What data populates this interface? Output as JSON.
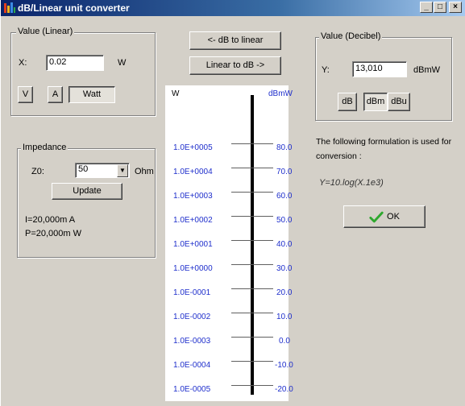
{
  "window": {
    "title": "dB/Linear unit converter",
    "controls": {
      "minimize": "_",
      "maximize": "□",
      "close": "×"
    }
  },
  "linear_group": {
    "legend": "Value (Linear)",
    "x_label": "X:",
    "x_value": "0.02",
    "unit": "W",
    "unit_buttons": [
      "V",
      "A",
      "Watt"
    ],
    "selected_unit": "Watt"
  },
  "impedance_group": {
    "legend": "Impedance",
    "z_label": "Z0:",
    "z_value": "50",
    "unit": "Ohm",
    "update_label": "Update",
    "current_text": "I=20,000m A",
    "power_text": "P=20,000m W"
  },
  "center_buttons": {
    "db_to_linear": "<- dB to linear",
    "linear_to_db": "Linear to dB ->"
  },
  "scale": {
    "left_header": "W",
    "right_header": "dBmW",
    "left_labels": [
      "1.0E+0005",
      "1.0E+0004",
      "1.0E+0003",
      "1.0E+0002",
      "1.0E+0001",
      "1.0E+0000",
      "1.0E-0001",
      "1.0E-0002",
      "1.0E-0003",
      "1.0E-0004",
      "1.0E-0005"
    ],
    "right_labels": [
      "80.0",
      "70.0",
      "60.0",
      "50.0",
      "40.0",
      "30.0",
      "20.0",
      "10.0",
      "0.0",
      "-10.0",
      "-20.0"
    ]
  },
  "decibel_group": {
    "legend": "Value (Decibel)",
    "y_label": "Y:",
    "y_value": "13,010",
    "unit": "dBmW",
    "unit_buttons": [
      "dB",
      "dBm",
      "dBu"
    ],
    "selected_unit": "dBm"
  },
  "info": {
    "text_line1": "The following formulation is used for",
    "text_line2": "conversion :",
    "formula": "Y=10.log(X.1e3)"
  },
  "ok_button": {
    "label": "OK",
    "icon": "checkmark-icon",
    "icon_color": "#2ea82e"
  },
  "colors": {
    "title_start": "#0a246a",
    "title_end": "#a6caf0",
    "scale_label": "#1f2fcc",
    "face": "#d4d0c8"
  }
}
